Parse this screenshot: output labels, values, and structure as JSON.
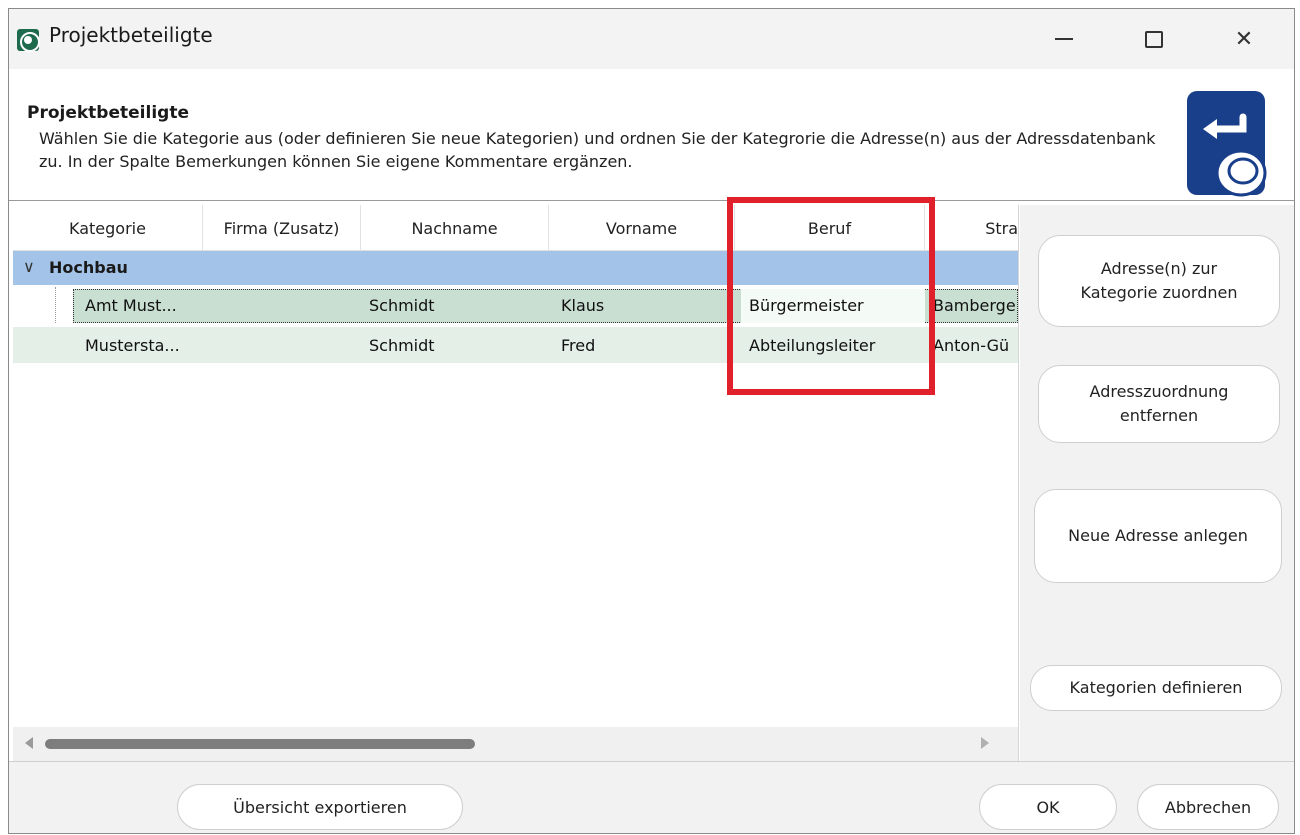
{
  "window": {
    "title": "Projektbeteiligte",
    "minimize_glyph": "—",
    "close_glyph": "✕"
  },
  "header": {
    "title": "Projektbeteiligte",
    "description": "Wählen Sie die Kategorie aus (oder definieren Sie neue Kategorien) und ordnen Sie der Kategrorie die Adresse(n) aus der Adressdatenbank zu. In der Spalte Bemerkungen können Sie eigene Kommentare ergänzen.",
    "icon": "enter-key-hand-icon"
  },
  "grid": {
    "columns": [
      "Kategorie",
      "Firma (Zusatz)",
      "Nachname",
      "Vorname",
      "Beruf",
      "Stra"
    ],
    "group": {
      "chevron": "∨",
      "label": "Hochbau"
    },
    "rows": [
      {
        "kategorie": "Amt Must...",
        "firma": "",
        "nachname": "Schmidt",
        "vorname": "Klaus",
        "beruf": "Bürgermeister",
        "strasse": "Bamberge",
        "selected": true
      },
      {
        "kategorie": "Mustersta...",
        "firma": "",
        "nachname": "Schmidt",
        "vorname": "Fred",
        "beruf": "Abteilungsleiter",
        "strasse": "Anton-Gü",
        "selected": false
      }
    ],
    "highlight_color": "#e0202a",
    "group_color": "#a3c4e8"
  },
  "side_buttons": {
    "assign": "Adresse(n) zur Kategorie zuordnen",
    "remove": "Adresszuordnung entfernen",
    "new_address": "Neue Adresse anlegen",
    "define_categories": "Kategorien definieren"
  },
  "footer": {
    "export": "Übersicht exportieren",
    "ok": "OK",
    "cancel": "Abbrechen"
  }
}
